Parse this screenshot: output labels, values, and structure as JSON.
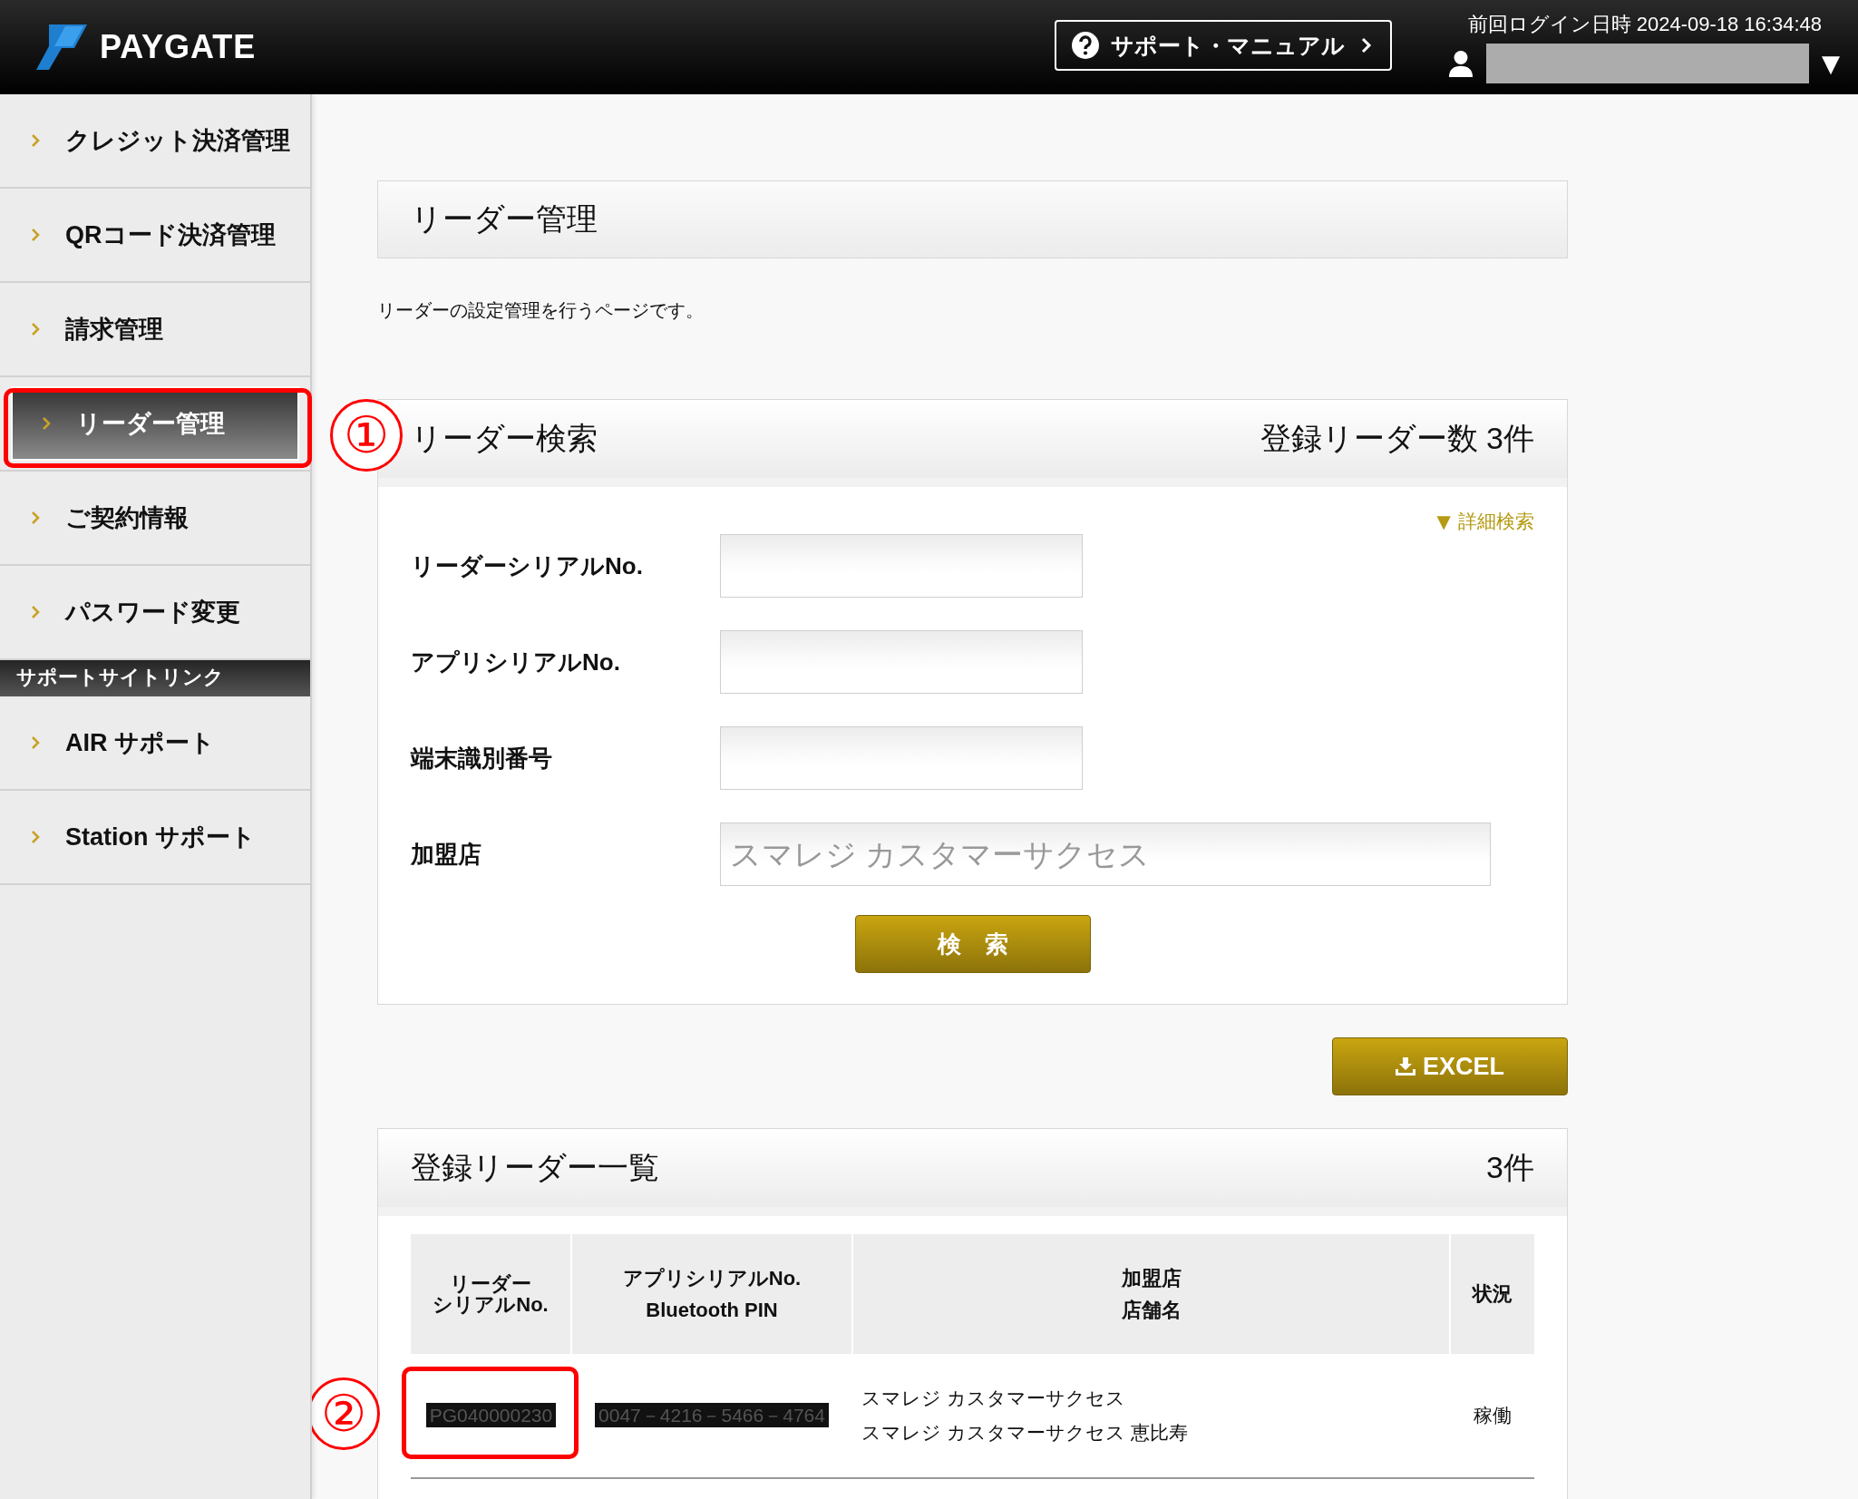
{
  "header": {
    "logo": "PAYGATE",
    "support_button": "サポート・マニュアル",
    "last_login": "前回ログイン日時 2024-09-18 16:34:48",
    "user_menu_caret": "▼"
  },
  "sidebar": {
    "items": [
      {
        "label": "クレジット決済管理",
        "selected": false
      },
      {
        "label": "QRコード決済管理",
        "selected": false
      },
      {
        "label": "請求管理",
        "selected": false
      },
      {
        "label": "リーダー管理",
        "selected": true,
        "callout": "①"
      },
      {
        "label": "ご契約情報",
        "selected": false
      },
      {
        "label": "パスワード変更",
        "selected": false
      }
    ],
    "section_title": "サポートサイトリンク",
    "support_links": [
      {
        "label": "AIR サポート",
        "selected": false
      },
      {
        "label": "Station サポート",
        "selected": false
      }
    ]
  },
  "page": {
    "title": "リーダー管理",
    "description": "リーダーの設定管理を行うページです。"
  },
  "search": {
    "title": "リーダー検索",
    "count": "登録リーダー数 3件",
    "advanced_toggle": {
      "icon": "▼",
      "label": "詳細検索"
    },
    "fields": [
      {
        "label": "リーダーシリアルNo.",
        "wide": false
      },
      {
        "label": "アプリシリアルNo.",
        "wide": false
      },
      {
        "label": "端末識別番号",
        "wide": false
      },
      {
        "label": "加盟店",
        "placeholder": "スマレジ カスタマーサクセス",
        "wide": true
      }
    ],
    "button": "検　索"
  },
  "excel_button": "EXCEL",
  "list": {
    "title": "登録リーダー一覧",
    "count": "3件",
    "columns": [
      {
        "lines": [
          "リーダー",
          "シリアルNo."
        ]
      },
      {
        "lines": [
          "アプリシリアルNo.",
          "Bluetooth PIN"
        ]
      },
      {
        "lines": [
          "加盟店",
          "店舗名"
        ]
      },
      {
        "lines": [
          "状況"
        ]
      }
    ],
    "rows": [
      {
        "cells": [
          {
            "lines": [
              "PG040000230"
            ],
            "redacted": true,
            "callout": "②"
          },
          {
            "lines": [
              "0047－4216－5466－4764"
            ],
            "redacted": true
          },
          {
            "lines": [
              "スマレジ カスタマーサクセス",
              "スマレジ カスタマーサクセス 恵比寿"
            ],
            "redacted": false
          },
          {
            "lines": [
              "稼働"
            ],
            "redacted": false
          }
        ]
      }
    ]
  }
}
